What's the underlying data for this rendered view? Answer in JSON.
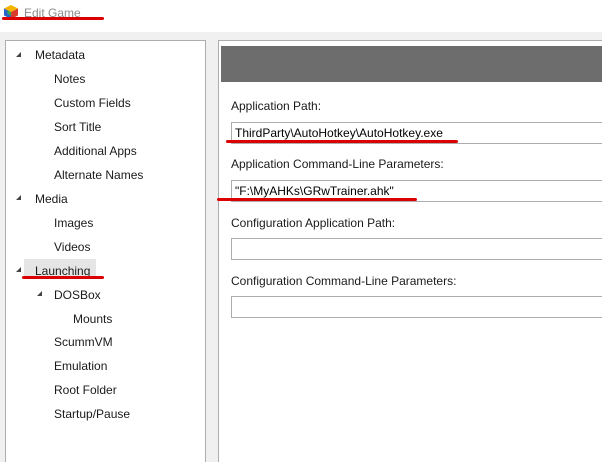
{
  "window": {
    "title": "Edit Game",
    "app_icon": "launchbox-icon"
  },
  "tree": {
    "items": [
      {
        "label": "Metadata",
        "level": 0,
        "expanded": true
      },
      {
        "label": "Notes",
        "level": 1
      },
      {
        "label": "Custom Fields",
        "level": 1
      },
      {
        "label": "Sort Title",
        "level": 1
      },
      {
        "label": "Additional Apps",
        "level": 1
      },
      {
        "label": "Alternate Names",
        "level": 1
      },
      {
        "label": "Media",
        "level": 0,
        "expanded": true
      },
      {
        "label": "Images",
        "level": 1
      },
      {
        "label": "Videos",
        "level": 1
      },
      {
        "label": "Launching",
        "level": 0,
        "expanded": true,
        "selected": true
      },
      {
        "label": "DOSBox",
        "level": 1,
        "expanded": true
      },
      {
        "label": "Mounts",
        "level": 2
      },
      {
        "label": "ScummVM",
        "level": 1
      },
      {
        "label": "Emulation",
        "level": 1
      },
      {
        "label": "Root Folder",
        "level": 1
      },
      {
        "label": "Startup/Pause",
        "level": 1
      }
    ]
  },
  "form": {
    "application_path_label": "Application Path:",
    "application_path_value": "ThirdParty\\AutoHotkey\\AutoHotkey.exe",
    "command_line_label": "Application Command-Line Parameters:",
    "command_line_value": "\"F:\\MyAHKs\\GRwTrainer.ahk\"",
    "config_path_label": "Configuration Application Path:",
    "config_path_value": "",
    "config_command_line_label": "Configuration Command-Line Parameters:",
    "config_command_line_value": ""
  },
  "colors": {
    "annotation_red": "#dd0000",
    "header_bar": "#6d6d6d",
    "selection": "#e5e5e5"
  }
}
